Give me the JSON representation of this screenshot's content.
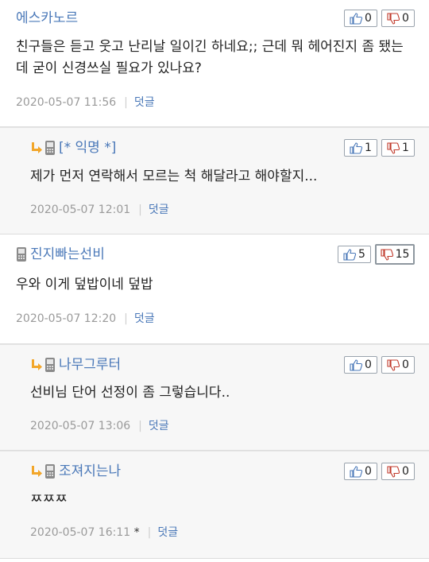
{
  "comments": [
    {
      "author": "에스카노르",
      "is_reply": false,
      "mobile": false,
      "text": "친구들은 듣고 웃고 난리날 일이긴 하네요;; 근데 뭐 헤어진지 좀 됐는데 굳이 신경쓰실 필요가 있나요?",
      "timestamp": "2020-05-07 11:56",
      "marker": "",
      "reply_label": "덧글",
      "up": "0",
      "down": "0"
    },
    {
      "author": "[* 익명 *]",
      "is_reply": true,
      "mobile": true,
      "text": "제가 먼저 연락해서 모르는 척 해달라고 해야할지...",
      "timestamp": "2020-05-07 12:01",
      "marker": "",
      "reply_label": "덧글",
      "up": "1",
      "down": "1"
    },
    {
      "author": "진지빠는선비",
      "is_reply": false,
      "mobile": true,
      "text": "우와 이게 덮밥이네 덮밥",
      "timestamp": "2020-05-07 12:20",
      "marker": "",
      "reply_label": "덧글",
      "up": "5",
      "down": "15"
    },
    {
      "author": "나무그루터",
      "is_reply": true,
      "mobile": true,
      "text": "선비님 단어 선정이 좀 그렇습니다..",
      "timestamp": "2020-05-07 13:06",
      "marker": "",
      "reply_label": "덧글",
      "up": "0",
      "down": "0"
    },
    {
      "author": "조져지는나",
      "is_reply": true,
      "mobile": true,
      "text": "ㅉㅉㅉ",
      "timestamp": "2020-05-07 16:11",
      "marker": "*",
      "reply_label": "덧글",
      "up": "0",
      "down": "0"
    }
  ],
  "colors": {
    "author": "#4a78b8",
    "reply_bg": "#f7f7f7",
    "meta": "#9a9a9a",
    "reply_arrow": "#f2a62a"
  },
  "icons": {
    "reply_arrow": "reply-arrow-icon",
    "mobile": "mobile-phone-icon",
    "upvote": "thumbs-up-icon",
    "downvote": "thumbs-down-icon"
  }
}
